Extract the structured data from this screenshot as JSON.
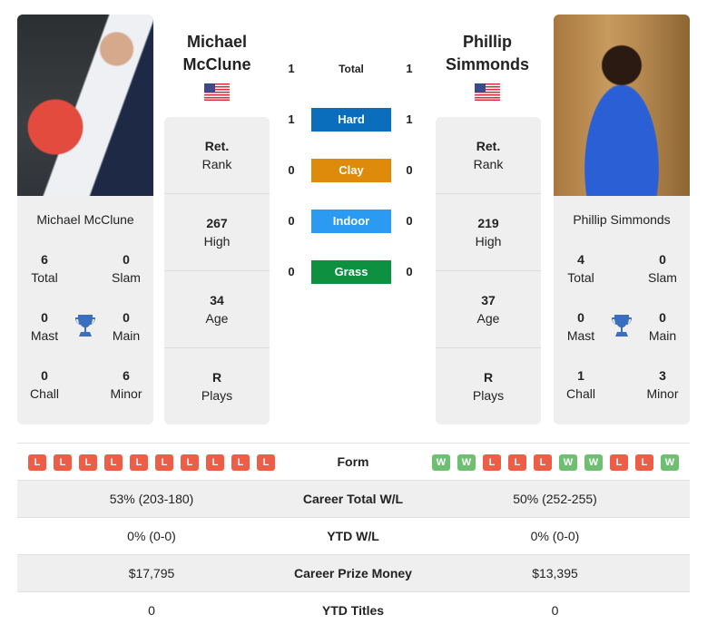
{
  "players": {
    "left": {
      "name": "Michael McClune",
      "name_line1": "Michael",
      "name_line2": "McClune",
      "country_flag": "us-flag-icon",
      "titles": {
        "total": {
          "value": "6",
          "label": "Total"
        },
        "slam": {
          "value": "0",
          "label": "Slam"
        },
        "mast": {
          "value": "0",
          "label": "Mast"
        },
        "main": {
          "value": "0",
          "label": "Main"
        },
        "chall": {
          "value": "0",
          "label": "Chall"
        },
        "minor": {
          "value": "6",
          "label": "Minor"
        }
      },
      "info": {
        "rank": {
          "value": "Ret.",
          "label": "Rank"
        },
        "high": {
          "value": "267",
          "label": "High"
        },
        "age": {
          "value": "34",
          "label": "Age"
        },
        "plays": {
          "value": "R",
          "label": "Plays"
        }
      }
    },
    "right": {
      "name": "Phillip Simmonds",
      "name_line1": "Phillip",
      "name_line2": "Simmonds",
      "country_flag": "us-flag-icon",
      "titles": {
        "total": {
          "value": "4",
          "label": "Total"
        },
        "slam": {
          "value": "0",
          "label": "Slam"
        },
        "mast": {
          "value": "0",
          "label": "Mast"
        },
        "main": {
          "value": "0",
          "label": "Main"
        },
        "chall": {
          "value": "1",
          "label": "Chall"
        },
        "minor": {
          "value": "3",
          "label": "Minor"
        }
      },
      "info": {
        "rank": {
          "value": "Ret.",
          "label": "Rank"
        },
        "high": {
          "value": "219",
          "label": "High"
        },
        "age": {
          "value": "37",
          "label": "Age"
        },
        "plays": {
          "value": "R",
          "label": "Plays"
        }
      }
    }
  },
  "h2h": {
    "rows": [
      {
        "label": "Total",
        "left": "1",
        "right": "1",
        "color": ""
      },
      {
        "label": "Hard",
        "left": "1",
        "right": "1",
        "color": "#0a6ebd"
      },
      {
        "label": "Clay",
        "left": "0",
        "right": "0",
        "color": "#de8a0a"
      },
      {
        "label": "Indoor",
        "left": "0",
        "right": "0",
        "color": "#2b9af3"
      },
      {
        "label": "Grass",
        "left": "0",
        "right": "0",
        "color": "#0d9140"
      }
    ]
  },
  "comparison": {
    "form": {
      "label": "Form",
      "left": [
        "L",
        "L",
        "L",
        "L",
        "L",
        "L",
        "L",
        "L",
        "L",
        "L"
      ],
      "right": [
        "W",
        "W",
        "L",
        "L",
        "L",
        "W",
        "W",
        "L",
        "L",
        "W"
      ]
    },
    "rows": [
      {
        "label": "Career Total W/L",
        "left": "53% (203-180)",
        "right": "50% (252-255)"
      },
      {
        "label": "YTD W/L",
        "left": "0% (0-0)",
        "right": "0% (0-0)"
      },
      {
        "label": "Career Prize Money",
        "left": "$17,795",
        "right": "$13,395"
      },
      {
        "label": "YTD Titles",
        "left": "0",
        "right": "0"
      }
    ]
  },
  "colors": {
    "loss": "#ee5d45",
    "win": "#6fbf73",
    "trophy": "#3a6fbf",
    "card_bg": "#efefef"
  }
}
